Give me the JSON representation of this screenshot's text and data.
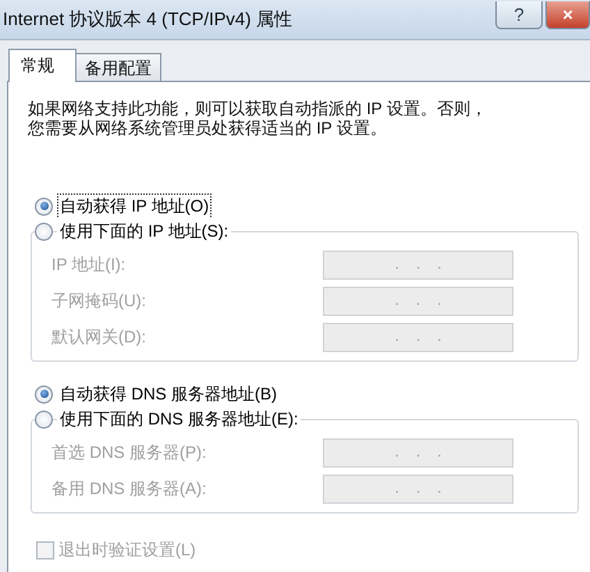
{
  "window": {
    "title": "Internet 协议版本 4 (TCP/IPv4) 属性",
    "buttons": [
      {
        "kind": "help",
        "label": "?"
      },
      {
        "kind": "close",
        "label": "×"
      }
    ]
  },
  "tabs": [
    {
      "label": "常规",
      "selected": true
    },
    {
      "label": "备用配置",
      "selected": false
    }
  ],
  "description": [
    "如果网络支持此功能，则可以获取自动指派的 IP 设置。否则，",
    "您需要从网络系统管理员处获得适当的 IP 设置。"
  ],
  "sections": [
    {
      "options": [
        {
          "label": "自动获得 IP 地址(O)",
          "selected": true,
          "focused": true
        },
        {
          "label": "使用下面的 IP 地址(S):",
          "selected": false,
          "focused": false
        }
      ],
      "fields": [
        {
          "label": "IP 地址(I):",
          "value": ".    .    .",
          "disabled": true
        },
        {
          "label": "子网掩码(U):",
          "value": ".    .    .",
          "disabled": true
        },
        {
          "label": "默认网关(D):",
          "value": ".    .    .",
          "disabled": true
        }
      ]
    },
    {
      "options": [
        {
          "label": "自动获得 DNS 服务器地址(B)",
          "selected": true,
          "focused": false
        },
        {
          "label": "使用下面的 DNS 服务器地址(E):",
          "selected": false,
          "focused": false
        }
      ],
      "fields": [
        {
          "label": "首选 DNS 服务器(P):",
          "value": ".    .    .",
          "disabled": true
        },
        {
          "label": "备用 DNS 服务器(A):",
          "value": ".    .    .",
          "disabled": true
        }
      ]
    }
  ],
  "checkbox": {
    "label": "退出时验证设置(L)",
    "checked": false,
    "disabled": true
  }
}
